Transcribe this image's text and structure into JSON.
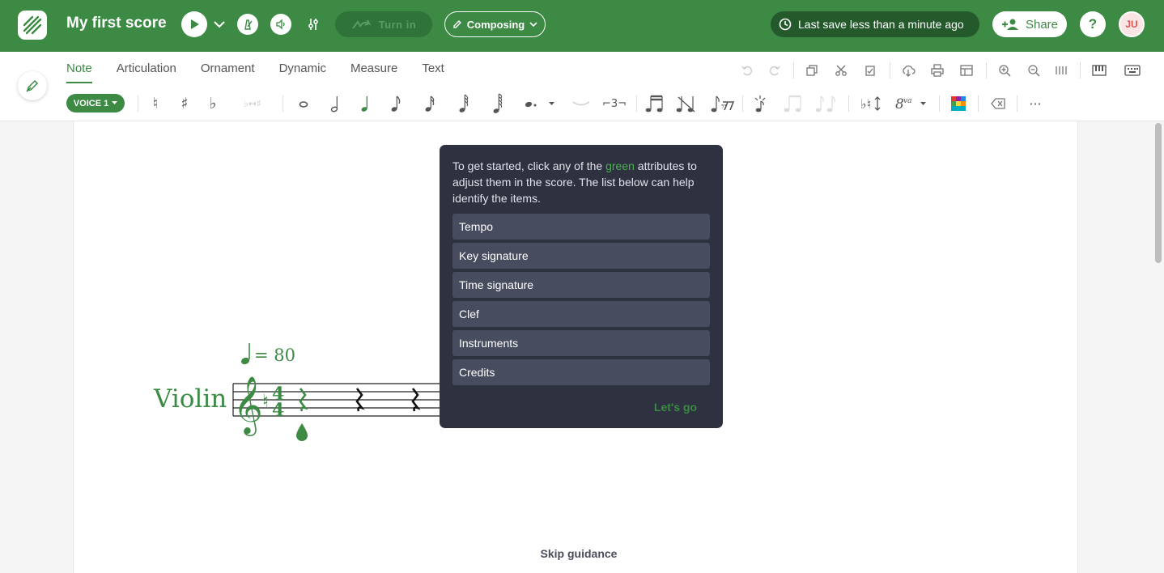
{
  "header": {
    "title": "My first score",
    "turn_in_label": "Turn in",
    "mode_label": "Composing",
    "last_save": "Last save less than a minute ago",
    "share_label": "Share",
    "help_label": "?",
    "avatar_initials": "JU"
  },
  "tabs": [
    {
      "label": "Note",
      "active": true
    },
    {
      "label": "Articulation",
      "active": false
    },
    {
      "label": "Ornament",
      "active": false
    },
    {
      "label": "Dynamic",
      "active": false
    },
    {
      "label": "Measure",
      "active": false
    },
    {
      "label": "Text",
      "active": false
    }
  ],
  "voice_label": "VOICE 1",
  "score": {
    "instrument": "Violin",
    "tempo": "= 80"
  },
  "guidance": {
    "intro_before": "To get started, click any of the ",
    "intro_green": "green",
    "intro_after": " attributes to adjust them in the score. The list below can help identify the items.",
    "items": [
      "Tempo",
      "Key signature",
      "Time signature",
      "Clef",
      "Instruments",
      "Credits"
    ],
    "cta": "Let's go",
    "skip": "Skip guidance"
  },
  "colors": {
    "brand_green": "#3c8a44",
    "popover_bg": "#2d3140",
    "item_bg": "#474c5e"
  }
}
